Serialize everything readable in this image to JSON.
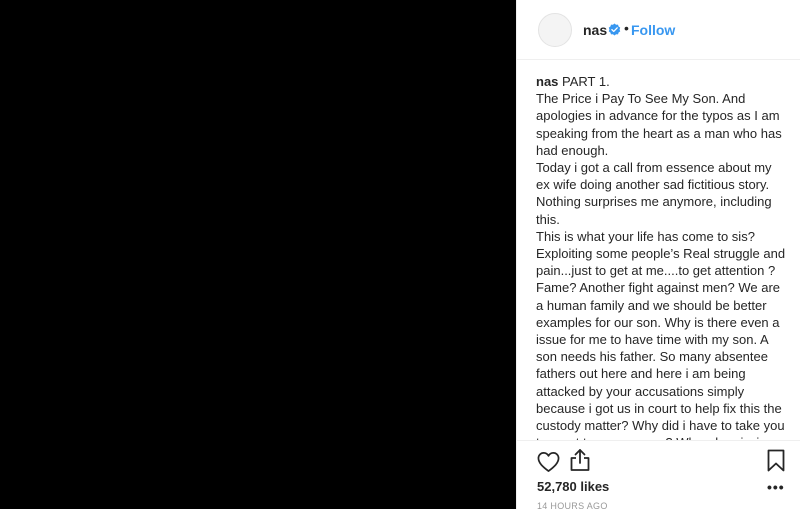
{
  "header": {
    "username": "nas",
    "separator": "•",
    "follow_label": "Follow"
  },
  "caption": {
    "username": "nas",
    "text": " PART 1.\nThe Price i Pay To See My Son. And apologies in advance for the typos as I am speaking from the heart as a man who has had enough.\nToday i got a call from essence about my ex wife doing another sad fictitious story. Nothing surprises me anymore, including this.\nThis is what your life has come to sis? Exploiting some people’s Real struggle and pain...just to get at me....to get attention ? Fame? Another fight against men? We are a human family and we should be better examples for our son. Why is there even a issue for me to have time with my son. A son needs his father. So many absentee fathers out here and here i am being attacked by your accusations simply because i got us in court to help fix this the custody matter? Why did i have to take you to court to see our son? Why when i win the joint custody ( which is a win for both of us and our son, it helps us with both our schedules) why do"
  },
  "stats": {
    "likes": "52,780 likes",
    "timestamp": "14 HOURS AGO",
    "more": "•••"
  },
  "icons": {
    "verified": "verified-badge-icon",
    "heart": "heart-icon",
    "share": "share-icon",
    "bookmark": "bookmark-icon"
  },
  "colors": {
    "media_background": "#000000",
    "link": "#3897f0",
    "text": "#262626",
    "muted": "#999999"
  }
}
